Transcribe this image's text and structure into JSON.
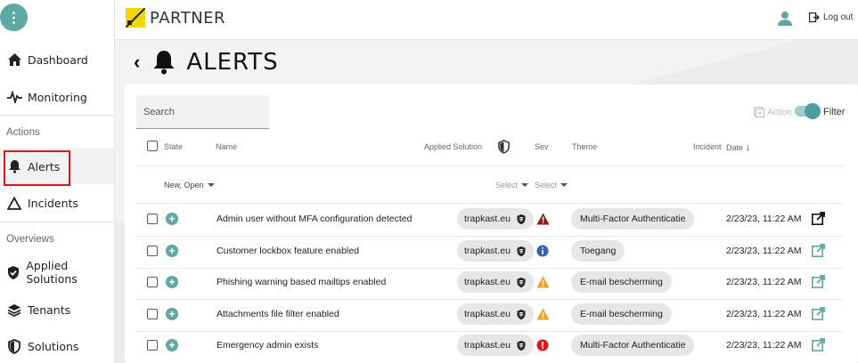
{
  "app": {
    "brand": "PARTNER",
    "logout_label": "Log out"
  },
  "sidebar": {
    "items": [
      {
        "label": "Dashboard"
      },
      {
        "label": "Monitoring"
      },
      {
        "label": "Alerts"
      },
      {
        "label": "Incidents"
      },
      {
        "label": "Applied Solutions"
      },
      {
        "label": "Tenants"
      },
      {
        "label": "Solutions"
      }
    ],
    "sections": {
      "actions": "Actions",
      "overviews": "Overviews"
    }
  },
  "page": {
    "title": "ALERTS"
  },
  "toolbar": {
    "search_placeholder": "Search",
    "action_label": "Action",
    "filter_label": "Filter"
  },
  "table": {
    "columns": {
      "state": "State",
      "name": "Name",
      "applied_solution": "Applied Solution",
      "sev": "Sev",
      "theme": "Theme",
      "incident": "Incident",
      "date": "Date"
    },
    "filters": {
      "state": "New, Open",
      "applied_solution": "Select",
      "sev": "Select"
    },
    "rows": [
      {
        "name": "Admin user without MFA configuration detected",
        "tenant": "trapkast.eu",
        "severity": "high",
        "theme": "Multi-Factor Authenticatie",
        "date": "2/23/23, 11:22 AM"
      },
      {
        "name": "Customer lockbox feature enabled",
        "tenant": "trapkast.eu",
        "severity": "info",
        "theme": "Toegang",
        "date": "2/23/23, 11:22 AM"
      },
      {
        "name": "Phishing warning based mailtips enabled",
        "tenant": "trapkast.eu",
        "severity": "warning",
        "theme": "E-mail bescherming",
        "date": "2/23/23, 11:22 AM"
      },
      {
        "name": "Attachments file filter enabled",
        "tenant": "trapkast.eu",
        "severity": "warning",
        "theme": "E-mail bescherming",
        "date": "2/23/23, 11:22 AM"
      },
      {
        "name": "Emergency admin exists",
        "tenant": "trapkast.eu",
        "severity": "critical",
        "theme": "Multi-Factor Authenticatie",
        "date": "2/23/23, 11:22 AM"
      }
    ]
  },
  "colors": {
    "accent": "#5fa8a4",
    "brand_yellow": "#f2d600",
    "highlight_red": "#e0151b",
    "sev_high": "#8b1a1a",
    "sev_info": "#2f66b3",
    "sev_warning": "#f0a020",
    "sev_critical": "#e0151b"
  }
}
